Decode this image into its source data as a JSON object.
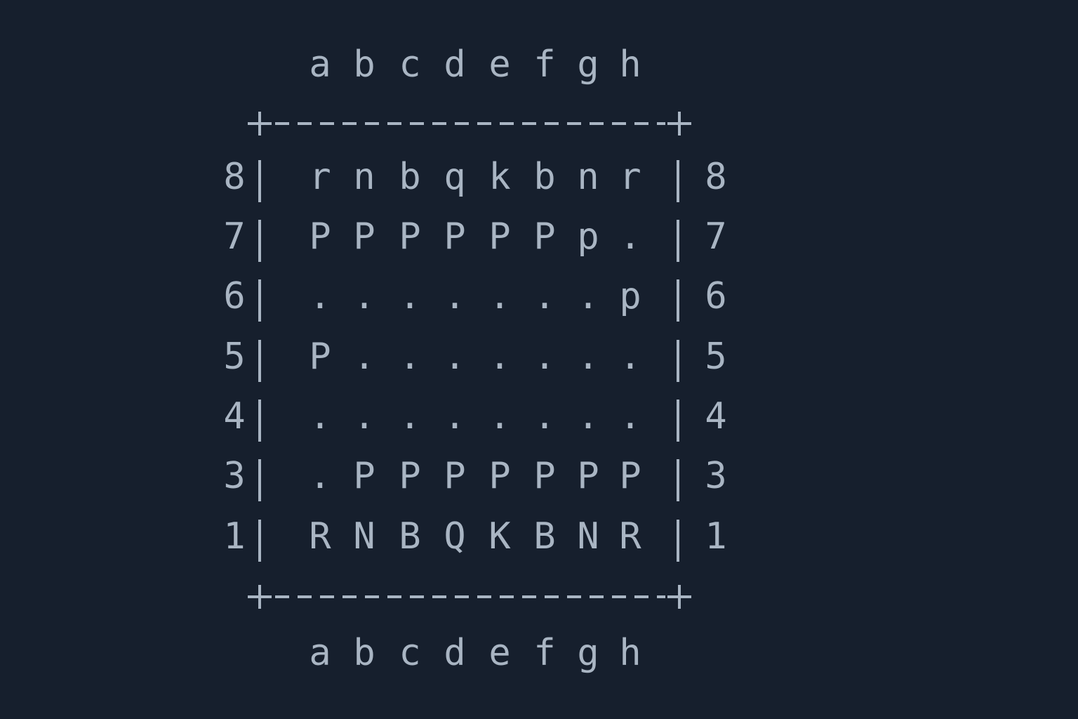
{
  "files_top": [
    "a",
    "b",
    "c",
    "d",
    "e",
    "f",
    "g",
    "h"
  ],
  "files_bottom": [
    "a",
    "b",
    "c",
    "d",
    "e",
    "f",
    "g",
    "h"
  ],
  "rows": [
    {
      "rank": "8",
      "cells": [
        "r",
        "n",
        "b",
        "q",
        "k",
        "b",
        "n",
        "r"
      ]
    },
    {
      "rank": "7",
      "cells": [
        "P",
        "P",
        "P",
        "P",
        "P",
        "P",
        "p",
        "."
      ]
    },
    {
      "rank": "6",
      "cells": [
        ".",
        ".",
        ".",
        ".",
        ".",
        ".",
        ".",
        "p"
      ]
    },
    {
      "rank": "5",
      "cells": [
        "P",
        ".",
        ".",
        ".",
        ".",
        ".",
        ".",
        "."
      ]
    },
    {
      "rank": "4",
      "cells": [
        ".",
        ".",
        ".",
        ".",
        ".",
        ".",
        ".",
        "."
      ]
    },
    {
      "rank": "3",
      "cells": [
        ".",
        "P",
        "P",
        "P",
        "P",
        "P",
        "P",
        "P"
      ]
    },
    {
      "rank": "1",
      "cells": [
        "R",
        "N",
        "B",
        "Q",
        "K",
        "B",
        "N",
        "R"
      ]
    }
  ],
  "colors": {
    "background": "#161f2d",
    "text": "#a9b5c3"
  }
}
